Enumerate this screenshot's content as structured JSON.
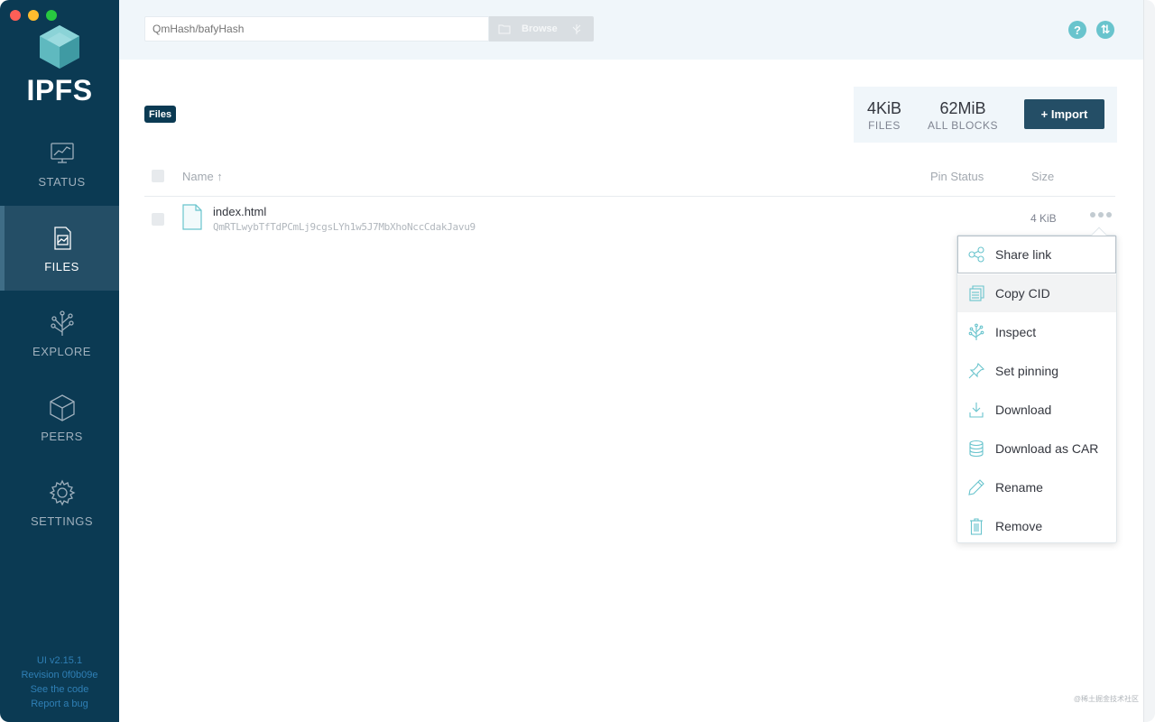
{
  "sidebar": {
    "logo_text": "IPFS",
    "items": [
      {
        "label": "STATUS",
        "icon": "status-icon"
      },
      {
        "label": "FILES",
        "icon": "files-icon"
      },
      {
        "label": "EXPLORE",
        "icon": "explore-icon"
      },
      {
        "label": "PEERS",
        "icon": "peers-icon"
      },
      {
        "label": "SETTINGS",
        "icon": "settings-icon"
      }
    ],
    "active_item": "FILES",
    "footer": {
      "version": "UI v2.15.1",
      "revision": "Revision 0f0b09e",
      "see_code": "See the code",
      "report_bug": "Report a bug"
    }
  },
  "topbar": {
    "search_placeholder": "QmHash/bafyHash",
    "browse_label": "Browse",
    "help_icon_glyph": "?",
    "sync_icon_glyph": "⇅"
  },
  "files": {
    "breadcrumb": "Files",
    "stats": {
      "files_value": "4KiB",
      "files_label": "FILES",
      "blocks_value": "62MiB",
      "blocks_label": "ALL BLOCKS"
    },
    "import_label": "+ Import",
    "table": {
      "col_name": "Name ↑",
      "col_pin": "Pin Status",
      "col_size": "Size"
    },
    "rows": [
      {
        "name": "index.html",
        "cid": "QmRTLwybTfTdPCmLj9cgsLYh1w5J7MbXhoNccCdakJavu9",
        "size": "4 KiB"
      }
    ]
  },
  "context_menu": {
    "items": [
      {
        "label": "Share link",
        "icon": "share-icon"
      },
      {
        "label": "Copy CID",
        "icon": "copy-icon"
      },
      {
        "label": "Inspect",
        "icon": "inspect-icon"
      },
      {
        "label": "Set pinning",
        "icon": "pin-icon"
      },
      {
        "label": "Download",
        "icon": "download-icon"
      },
      {
        "label": "Download as CAR",
        "icon": "database-icon"
      },
      {
        "label": "Rename",
        "icon": "pencil-icon"
      },
      {
        "label": "Remove",
        "icon": "trash-icon"
      }
    ]
  },
  "watermark": "@稀土掘金技术社区",
  "colors": {
    "sidebar_bg": "#0b3a53",
    "sidebar_active": "#244e66",
    "accent_teal": "#69c4cd",
    "import_button": "#244e66",
    "topbar_bg": "#f0f6fa"
  }
}
